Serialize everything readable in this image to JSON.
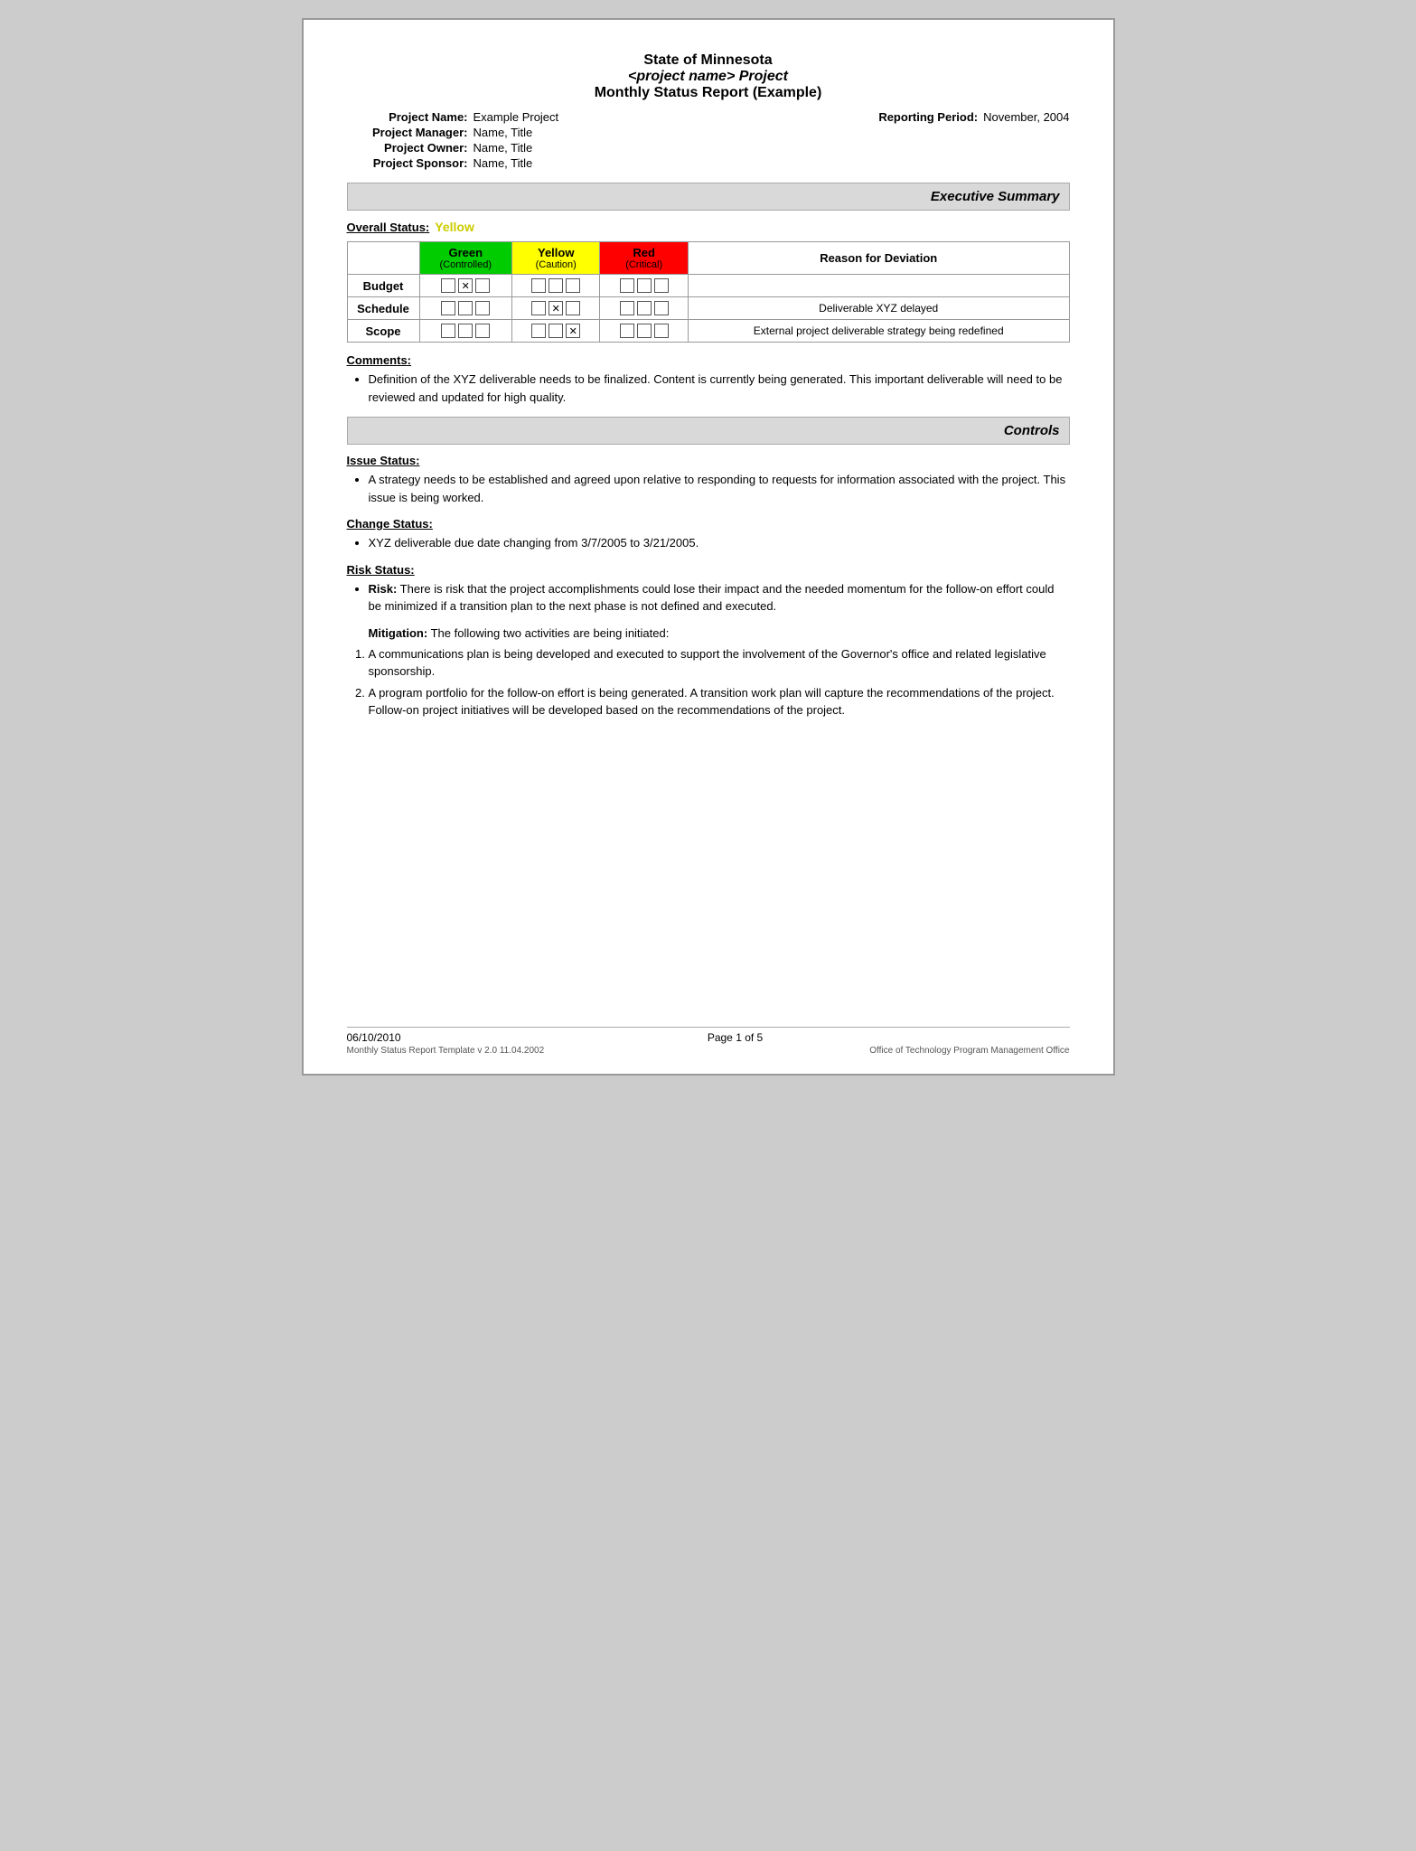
{
  "header": {
    "line1": "State of Minnesota",
    "line2": "<project name> Project",
    "line3": "Monthly Status Report (Example)"
  },
  "project_info": {
    "name_label": "Project Name:",
    "name_value": "Example Project",
    "reporting_label": "Reporting Period:",
    "reporting_value": "November, 2004",
    "manager_label": "Project Manager:",
    "manager_value": "Name, Title",
    "owner_label": "Project Owner:",
    "owner_value": "Name, Title",
    "sponsor_label": "Project Sponsor:",
    "sponsor_value": "Name, Title"
  },
  "executive_summary": {
    "section_label": "Executive Summary",
    "overall_status_label": "Overall Status:",
    "overall_status_value": "Yellow",
    "table": {
      "headers": {
        "green_label": "Green",
        "green_sub": "(Controlled)",
        "yellow_label": "Yellow",
        "yellow_sub": "(Caution)",
        "red_label": "Red",
        "red_sub": "(Critical)",
        "deviation_label": "Reason for Deviation"
      },
      "rows": [
        {
          "label": "Budget",
          "green": [
            false,
            true,
            false
          ],
          "yellow": [
            false,
            false,
            false
          ],
          "red": [
            false,
            false,
            false
          ],
          "deviation": ""
        },
        {
          "label": "Schedule",
          "green": [
            false,
            false,
            false
          ],
          "yellow": [
            false,
            true,
            false
          ],
          "red": [
            false,
            false,
            false
          ],
          "deviation": "Deliverable XYZ delayed"
        },
        {
          "label": "Scope",
          "green": [
            false,
            false,
            false
          ],
          "yellow": [
            false,
            false,
            true
          ],
          "red": [
            false,
            false,
            false
          ],
          "deviation": "External project deliverable strategy being redefined"
        }
      ]
    },
    "comments_label": "Comments:",
    "comments": [
      "Definition of the XYZ deliverable needs to be finalized.  Content is currently being generated.  This important deliverable will need to be reviewed and updated for high quality."
    ]
  },
  "controls": {
    "section_label": "Controls",
    "issue_label": "Issue Status:",
    "issue_bullets": [
      "A strategy needs to be established and agreed upon relative to responding to requests for information associated with the project.  This issue is being worked."
    ],
    "change_label": "Change Status:",
    "change_bullets": [
      "XYZ deliverable due date changing from 3/7/2005 to 3/21/2005."
    ],
    "risk_label": "Risk Status:",
    "risk_bullets": [
      {
        "prefix": "Risk:",
        "text": " There is risk that the project accomplishments could lose their impact and the needed momentum for the follow-on effort could be minimized if a transition plan to the next phase is not defined and executed."
      }
    ],
    "mitigation_label": "Mitigation:",
    "mitigation_intro": " The following two activities are being initiated:",
    "mitigation_items": [
      "A communications plan is being developed and executed to support the involvement of the Governor's office and related legislative sponsorship.",
      "A program portfolio for the follow-on effort is being generated. A transition work plan will capture the recommendations of the project. Follow-on project initiatives will be developed based on the recommendations of the project."
    ]
  },
  "footer": {
    "date": "06/10/2010",
    "page": "Page 1 of 5",
    "template_version": "Monthly Status Report Template  v 2.0  11.04.2002",
    "office": "Office of Technology Program Management Office"
  }
}
